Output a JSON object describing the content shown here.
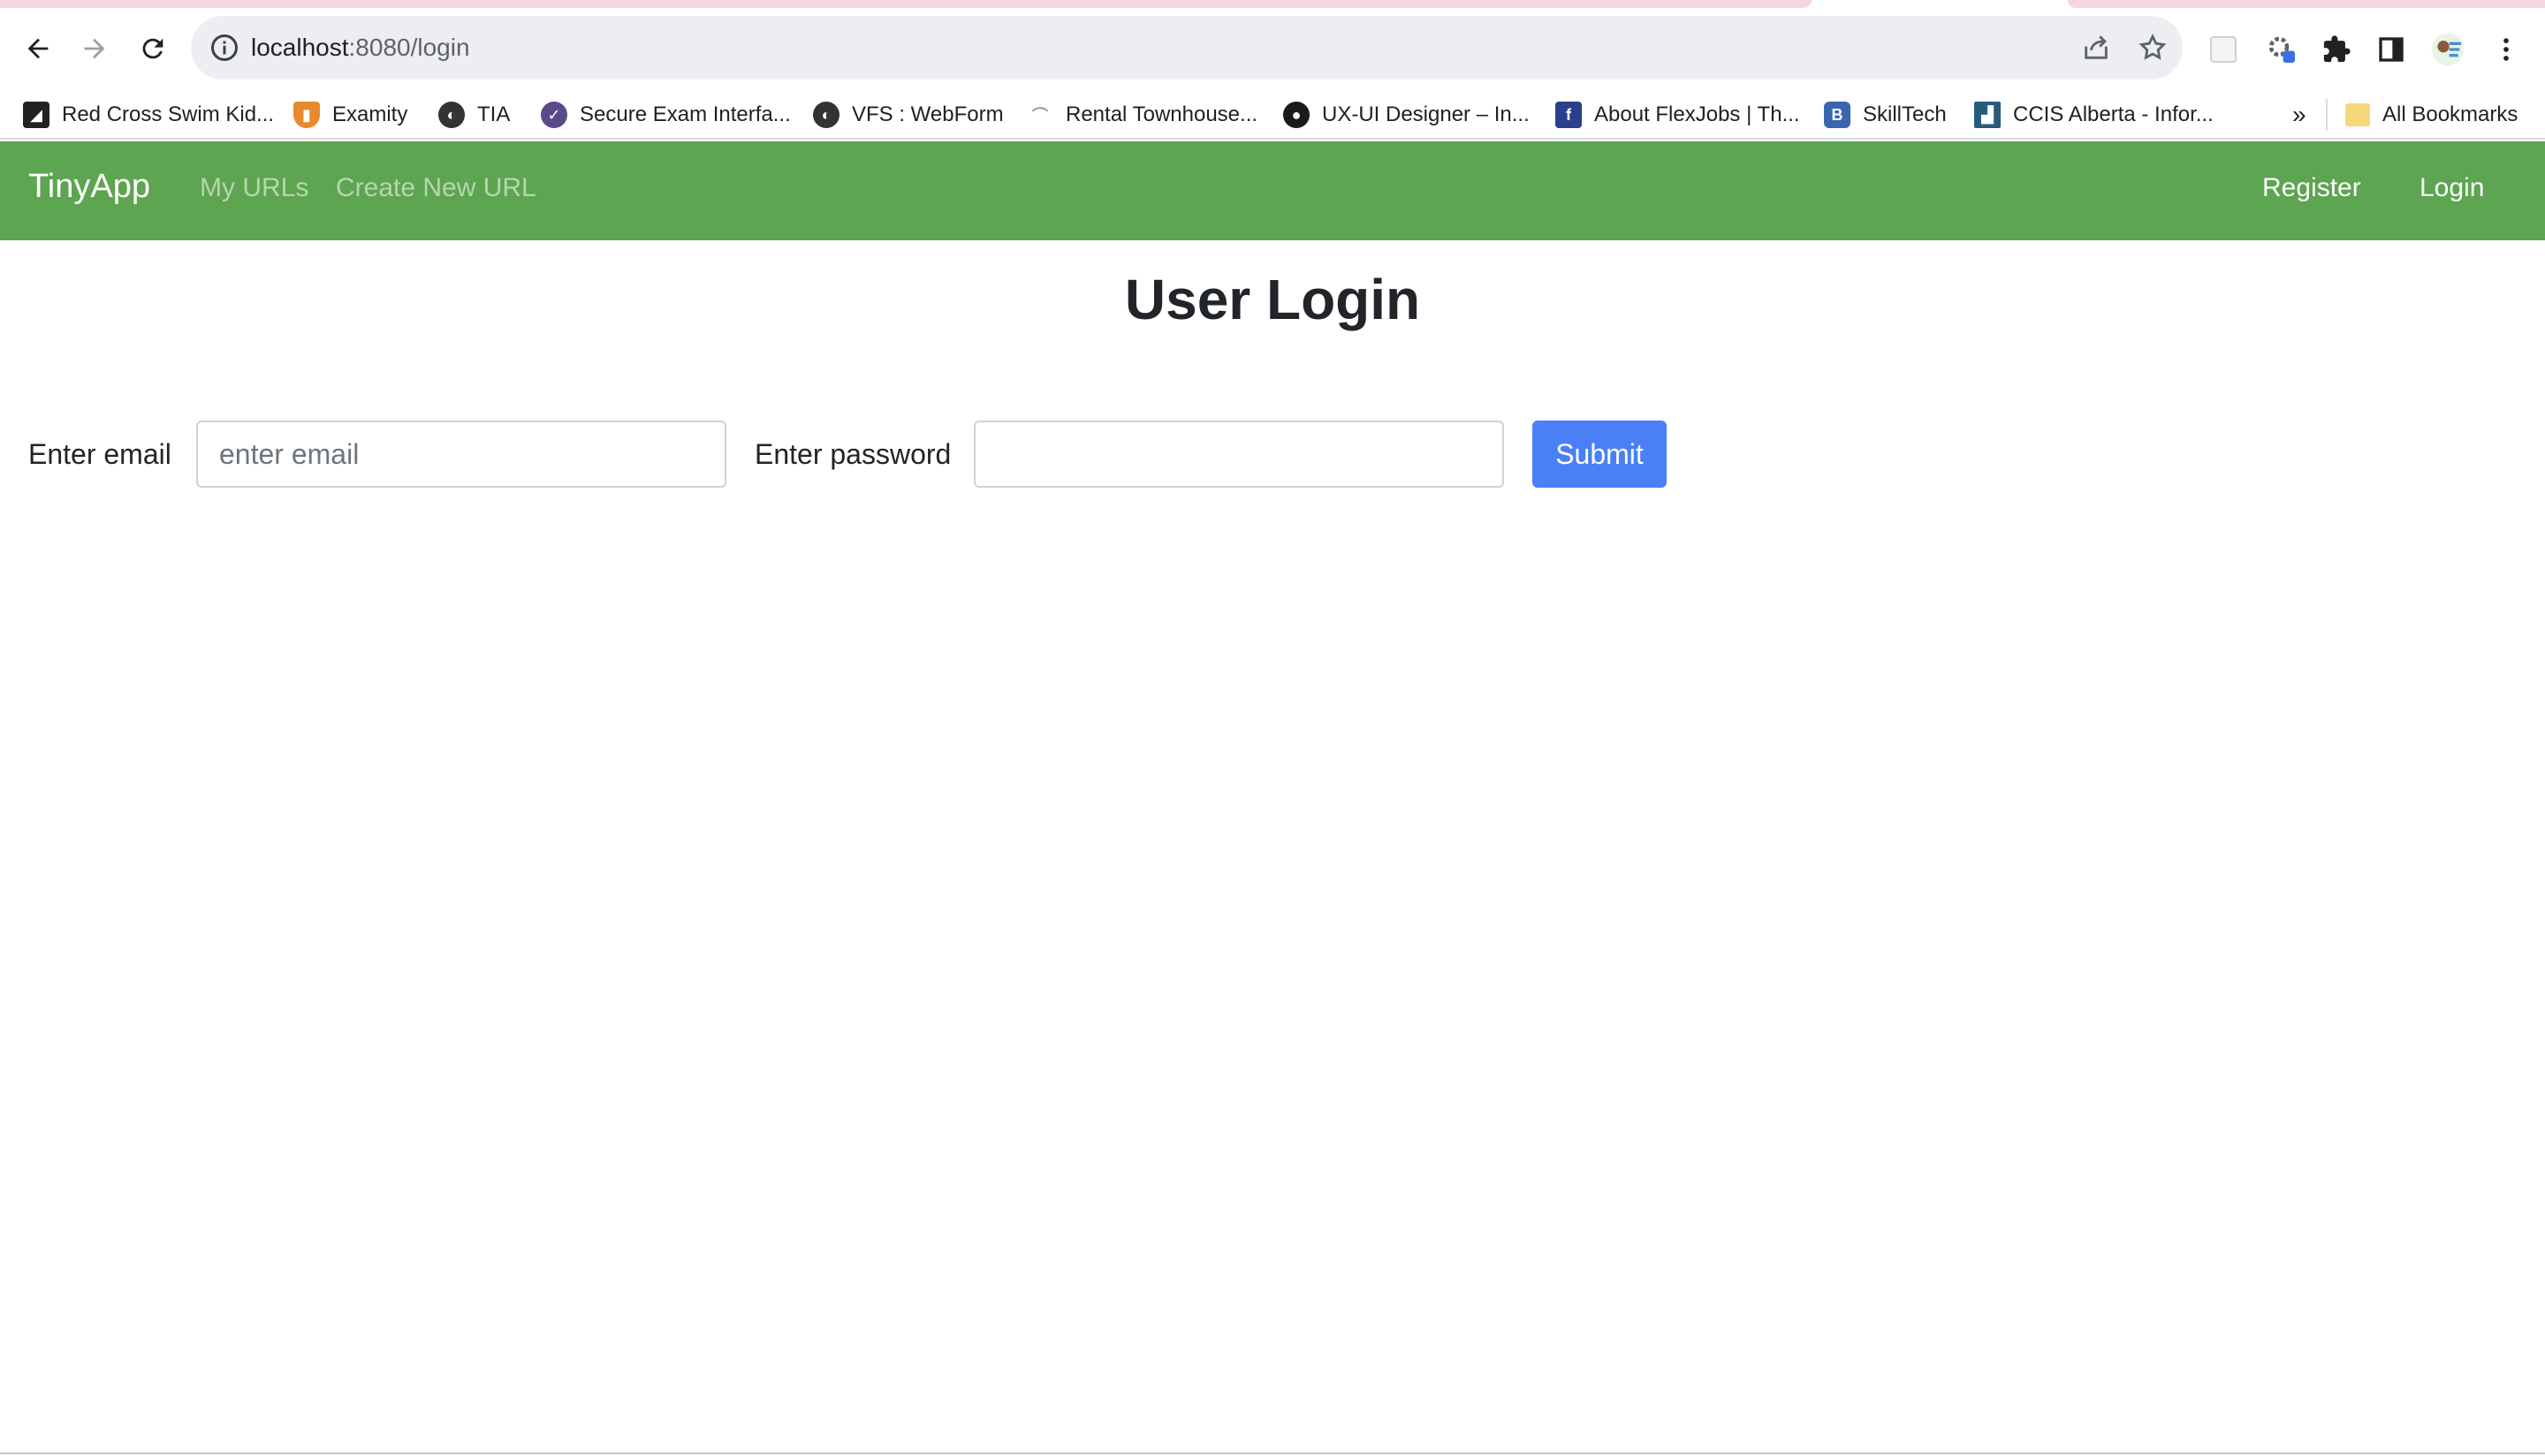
{
  "browser": {
    "url_host": "localhost",
    "url_path": ":8080/login",
    "bookmarks": [
      {
        "label": "Red Cross Swim Kid...",
        "icon": "red-cross-icon",
        "color": "#222222"
      },
      {
        "label": "Examity",
        "icon": "examity-icon",
        "color": "#e8892b"
      },
      {
        "label": "TIA",
        "icon": "globe-icon",
        "color": "#333333"
      },
      {
        "label": "Secure Exam Interfa...",
        "icon": "secure-exam-icon",
        "color": "#5b4a8a"
      },
      {
        "label": "VFS : WebForm",
        "icon": "globe-icon",
        "color": "#333333"
      },
      {
        "label": "Rental Townhouse...",
        "icon": "rental-icon",
        "color": "#9a9a9a"
      },
      {
        "label": "UX-UI Designer – In...",
        "icon": "ux-ui-icon",
        "color": "#1a1a1a"
      },
      {
        "label": "About FlexJobs | Th...",
        "icon": "flexjobs-icon",
        "color": "#2b3f8c"
      },
      {
        "label": "SkillTech",
        "icon": "skilltech-icon",
        "color": "#3a66b0"
      },
      {
        "label": "CCIS Alberta - Infor...",
        "icon": "ccis-icon",
        "color": "#2a5a7a"
      }
    ],
    "overflow_label": "»",
    "all_bookmarks_label": "All Bookmarks"
  },
  "navbar": {
    "brand": "TinyApp",
    "links": [
      "My URLs",
      "Create New URL"
    ],
    "register": "Register",
    "login": "Login",
    "color": "#5da550"
  },
  "page": {
    "title": "User Login",
    "email_label": "Enter email",
    "email_placeholder": "enter email",
    "email_value": "",
    "password_label": "Enter password",
    "password_value": "",
    "submit_label": "Submit",
    "submit_color": "#4a7ff5"
  }
}
